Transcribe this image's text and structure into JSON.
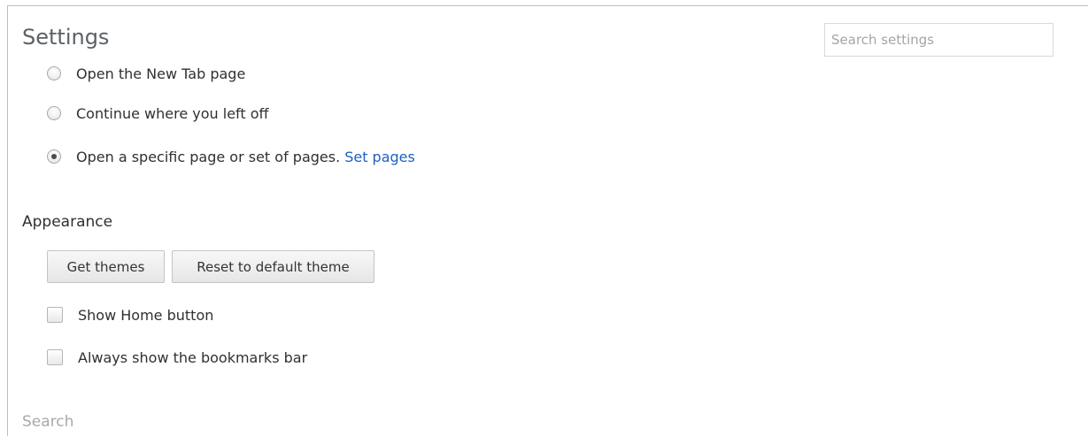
{
  "header": {
    "title": "Settings",
    "search_placeholder": "Search settings"
  },
  "startup": {
    "options": [
      {
        "label": "Open the New Tab page",
        "checked": false
      },
      {
        "label": "Continue where you left off",
        "checked": false
      },
      {
        "label": "Open a specific page or set of pages.",
        "checked": true,
        "link": "Set pages"
      }
    ]
  },
  "appearance": {
    "title": "Appearance",
    "get_themes": "Get themes",
    "reset_theme": "Reset to default theme",
    "show_home": "Show Home button",
    "show_bookmarks": "Always show the bookmarks bar"
  },
  "search_section": {
    "title": "Search"
  }
}
